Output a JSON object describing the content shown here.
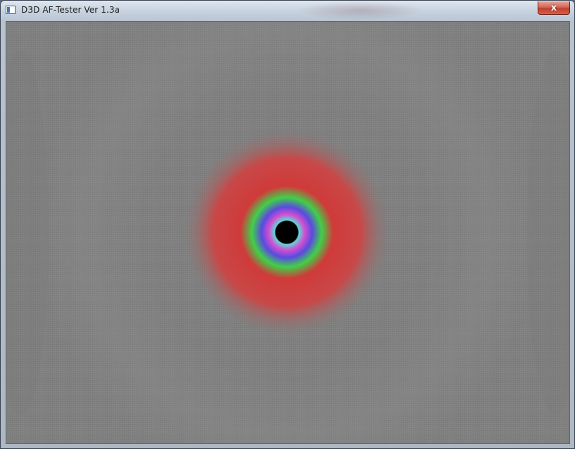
{
  "window": {
    "title": "D3D AF-Tester Ver 1.3a",
    "close_glyph": "x",
    "icon": "app-window-icon"
  },
  "render": {
    "description_colors": {
      "background": "#808080",
      "outer_ring": "#d03a3a",
      "green_ring": "#40d040",
      "blue_ring": "#5050e0",
      "magenta_ring": "#d050d0",
      "cyan_ring": "#40c8d0",
      "center": "#000000"
    }
  }
}
